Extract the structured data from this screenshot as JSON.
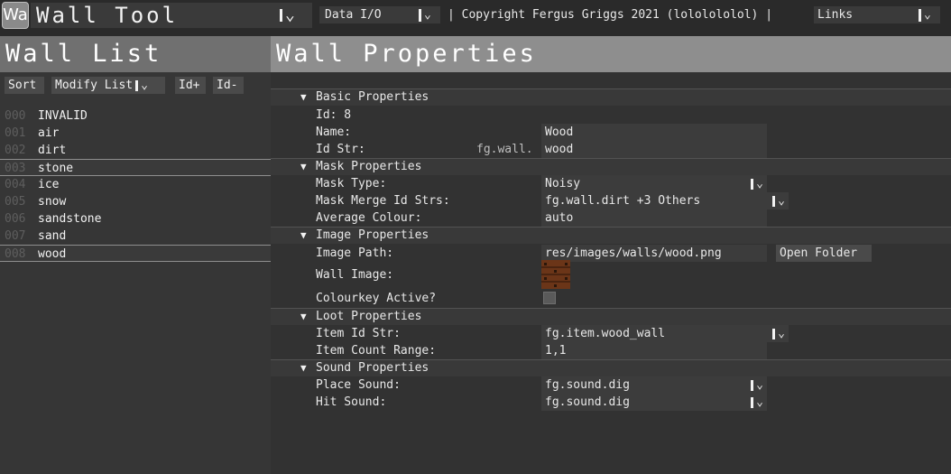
{
  "app": {
    "icon_text": "Wa",
    "title": "Wall Tool",
    "data_menu": "Data I/O",
    "copyright": "| Copyright Fergus Griggs 2021 (lololololol) |",
    "links_menu": "Links"
  },
  "headings": {
    "wall_list": "Wall List",
    "wall_properties": "Wall Properties"
  },
  "list_toolbar": {
    "sort": "Sort",
    "modify": "Modify List",
    "id_plus": "Id+",
    "id_minus": "Id-"
  },
  "walls": [
    {
      "num": "000",
      "name": "INVALID"
    },
    {
      "num": "001",
      "name": "air"
    },
    {
      "num": "002",
      "name": "dirt"
    },
    {
      "num": "003",
      "name": "stone"
    },
    {
      "num": "004",
      "name": "ice"
    },
    {
      "num": "005",
      "name": "snow"
    },
    {
      "num": "006",
      "name": "sandstone"
    },
    {
      "num": "007",
      "name": "sand"
    },
    {
      "num": "008",
      "name": "wood"
    }
  ],
  "sections": {
    "basic": "Basic Properties",
    "mask": "Mask Properties",
    "image": "Image Properties",
    "loot": "Loot Properties",
    "sound": "Sound Properties"
  },
  "basic": {
    "id_label": "Id: 8",
    "name_label": "Name:",
    "name_value": "Wood",
    "idstr_label": "Id Str:",
    "idstr_prefix": "fg.wall.",
    "idstr_value": "wood"
  },
  "mask": {
    "type_label": "Mask Type:",
    "type_value": "Noisy",
    "merge_label": "Mask Merge Id Strs:",
    "merge_value": "fg.wall.dirt +3 Others",
    "colour_label": "Average Colour:",
    "colour_value": "auto"
  },
  "image": {
    "path_label": "Image Path:",
    "path_value": "res/images/walls/wood.png",
    "open_folder": "Open Folder",
    "wall_image_label": "Wall Image:",
    "colourkey_label": "Colourkey Active?"
  },
  "loot": {
    "item_label": "Item Id Str:",
    "item_value": "fg.item.wood_wall",
    "count_label": "Item Count Range:",
    "count_value": "1,1"
  },
  "sound": {
    "place_label": "Place Sound:",
    "place_value": "fg.sound.dig",
    "hit_label": "Hit Sound:",
    "hit_value": "fg.sound.dig"
  },
  "colors": {
    "background": "#2a2a2a",
    "header_band": "#8e8e8e",
    "wood": "#6b3518"
  }
}
